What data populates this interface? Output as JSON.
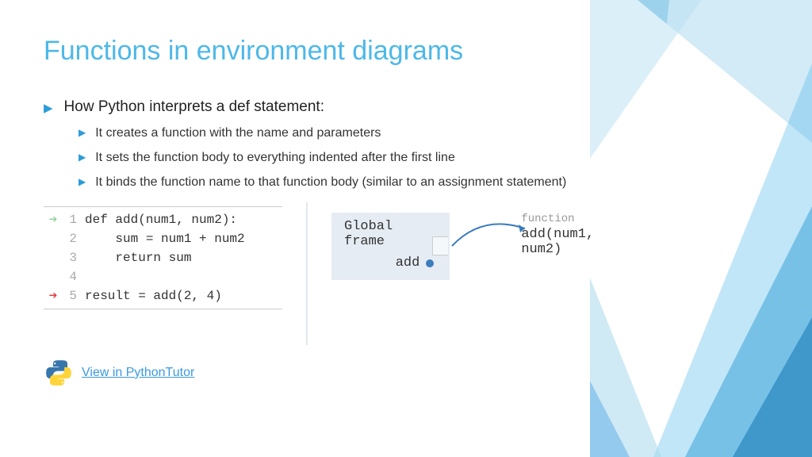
{
  "title": "Functions in environment diagrams",
  "mainBullet": "How Python interprets a def statement:",
  "subBullets": [
    "It creates a function with the name and parameters",
    "It sets the function body to everything indented after the first line",
    "It binds the function name to that function body (similar to an assignment statement)"
  ],
  "code": {
    "lines": [
      {
        "num": "1",
        "text": "def add(num1, num2):",
        "arrow": "green"
      },
      {
        "num": "2",
        "text": "    sum = num1 + num2",
        "arrow": ""
      },
      {
        "num": "3",
        "text": "    return sum",
        "arrow": ""
      },
      {
        "num": "4",
        "text": "",
        "arrow": ""
      },
      {
        "num": "5",
        "text": "result = add(2, 4)",
        "arrow": "red"
      }
    ]
  },
  "frame": {
    "title": "Global frame",
    "var": "add"
  },
  "func": {
    "label": "function",
    "sig": "add(num1, num2)"
  },
  "link": "View in PythonTutor"
}
